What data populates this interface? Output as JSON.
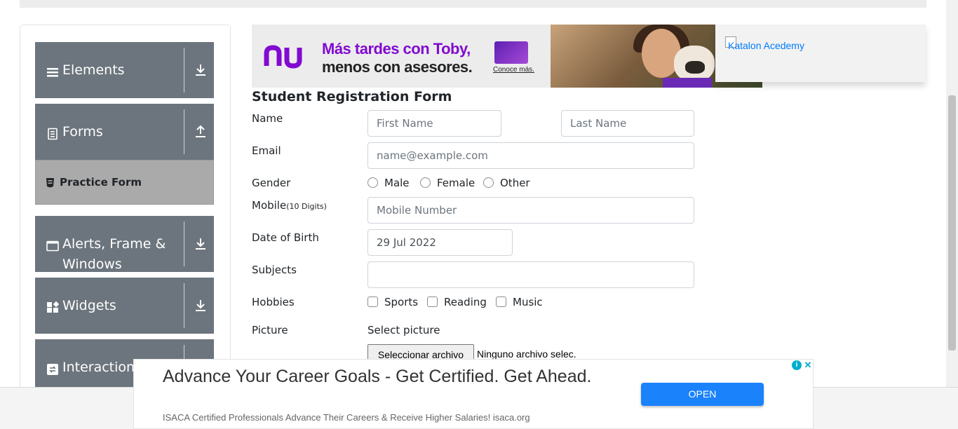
{
  "sidebar": {
    "groups": [
      {
        "label": "Elements",
        "icon": "list-icon",
        "arrow": "down"
      },
      {
        "label": "Forms",
        "icon": "document-icon",
        "arrow": "up"
      },
      {
        "label": "Alerts, Frame &\nWindows",
        "icon": "window-icon",
        "arrow": "down"
      },
      {
        "label": "Widgets",
        "icon": "widgets-icon",
        "arrow": "down"
      },
      {
        "label": "Interactions",
        "icon": "interactions-icon",
        "arrow": "down"
      }
    ],
    "active_item": {
      "label": "Practice Form",
      "icon": "html5-icon"
    }
  },
  "ad_top": {
    "brand": "nu",
    "line1": "Más tardes con Toby,",
    "line2": "menos con asesores.",
    "cta": "Conoce más."
  },
  "side_ad": {
    "alt_text": "Katalon Acedemy"
  },
  "form": {
    "title": "Student Registration Form",
    "name_label": "Name",
    "first_name_placeholder": "First Name",
    "last_name_placeholder": "Last Name",
    "email_label": "Email",
    "email_placeholder": "name@example.com",
    "gender_label": "Gender",
    "gender_options": [
      "Male",
      "Female",
      "Other"
    ],
    "mobile_label": "Mobile",
    "mobile_hint": "(10 Digits)",
    "mobile_placeholder": "Mobile Number",
    "dob_label": "Date of Birth",
    "dob_value": "29 Jul 2022",
    "subjects_label": "Subjects",
    "subjects_value": "",
    "hobbies_label": "Hobbies",
    "hobby_options": [
      "Sports",
      "Reading",
      "Music"
    ],
    "picture_label": "Picture",
    "select_picture": "Select picture",
    "file_button": "Seleccionar archivo",
    "file_status": "Ninguno archivo selec."
  },
  "bottom_ad": {
    "headline": "Advance Your Career Goals - Get Certified. Get Ahead.",
    "subtext": "ISACA Certified Professionals Advance Their Careers & Receive Higher Salaries! isaca.org",
    "open_label": "OPEN",
    "adchoices_label": "i",
    "close_label": "✕"
  },
  "colors": {
    "sidebar_group_bg": "#6c757d",
    "active_item_bg": "#aaaaaa",
    "nu_purple": "#820ad1",
    "open_button": "#1a82fb"
  }
}
